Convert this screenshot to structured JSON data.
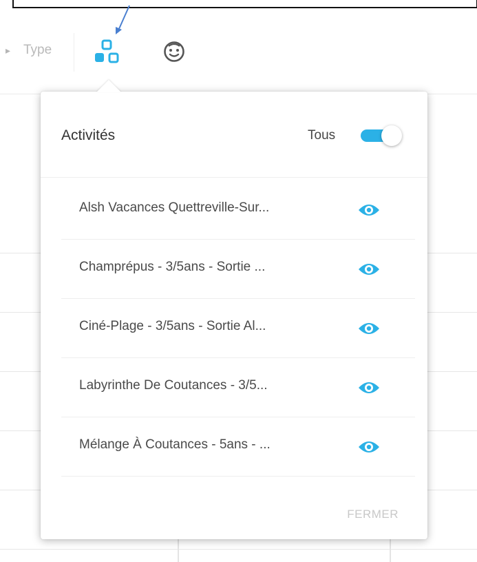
{
  "toolbar": {
    "type_label": "Type",
    "activities_icon": "blocks-icon",
    "children_icon": "smiley-icon"
  },
  "popover": {
    "title": "Activités",
    "all_label": "Tous",
    "all_enabled": true,
    "items": [
      {
        "label": "Alsh Vacances Quettreville-Sur...",
        "visible": true
      },
      {
        "label": "Champrépus - 3/5ans - Sortie ...",
        "visible": true
      },
      {
        "label": "Ciné-Plage - 3/5ans - Sortie Al...",
        "visible": true
      },
      {
        "label": "Labyrinthe De Coutances - 3/5...",
        "visible": true
      },
      {
        "label": "Mélange À Coutances - 5ans - ...",
        "visible": true
      }
    ],
    "close_label": "FERMER"
  },
  "colors": {
    "accent": "#2bb1e6",
    "text": "#4a4a4a",
    "muted": "#c8c8c8"
  }
}
